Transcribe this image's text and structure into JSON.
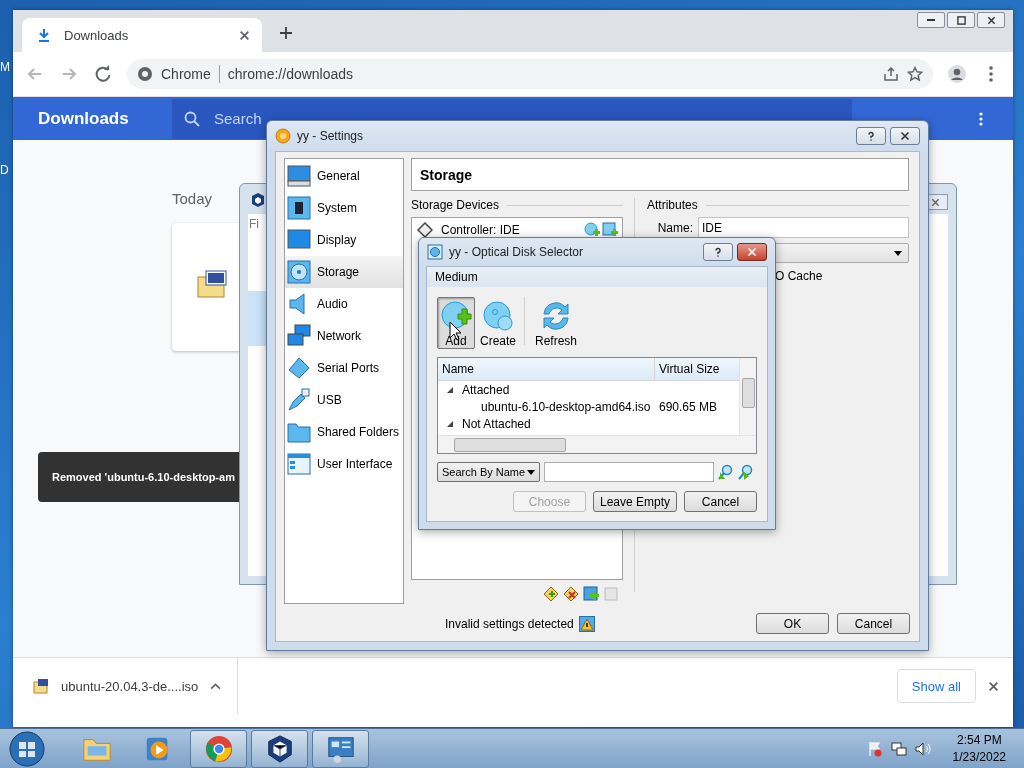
{
  "desktop": {
    "icon_labels": [
      "M",
      "D"
    ]
  },
  "browser": {
    "tab": {
      "title": "Downloads",
      "selected": true
    },
    "omnibox": {
      "chip": "Chrome",
      "url": "chrome://downloads"
    },
    "header": {
      "title": "Downloads",
      "search_placeholder": "Search"
    },
    "date_heading": "Today",
    "toast": "Removed 'ubuntu-6.10-desktop-am",
    "shelf": {
      "file": "ubuntu-20.04.3-de....iso",
      "show_all": "Show all"
    }
  },
  "manager_window": {
    "menu_fragment": "Fi"
  },
  "settings": {
    "title": "yy - Settings",
    "sections": [
      {
        "kind": "general",
        "label": "General",
        "selected": false
      },
      {
        "kind": "system",
        "label": "System",
        "selected": false
      },
      {
        "kind": "display",
        "label": "Display",
        "selected": false
      },
      {
        "kind": "storage",
        "label": "Storage",
        "selected": true
      },
      {
        "kind": "audio",
        "label": "Audio",
        "selected": false
      },
      {
        "kind": "network",
        "label": "Network",
        "selected": false
      },
      {
        "kind": "serial",
        "label": "Serial Ports",
        "selected": false
      },
      {
        "kind": "usb",
        "label": "USB",
        "selected": false
      },
      {
        "kind": "folders",
        "label": "Shared Folders",
        "selected": false
      },
      {
        "kind": "ui",
        "label": "User Interface",
        "selected": false
      }
    ],
    "page_title": "Storage",
    "devices_label": "Storage Devices",
    "controller": "Controller: IDE",
    "attributes_label": "Attributes",
    "name_label": "Name:",
    "name_value": "IDE",
    "cache_fragment": "O Cache",
    "status": "Invalid settings detected",
    "buttons": [
      "OK",
      "Cancel"
    ]
  },
  "disk_selector": {
    "title": "yy - Optical Disk Selector",
    "menu": [
      "Medium"
    ],
    "tools": [
      {
        "kind": "add",
        "label": "Add",
        "pressed": true
      },
      {
        "kind": "create",
        "label": "Create",
        "pressed": false
      },
      {
        "kind": "refresh",
        "label": "Refresh",
        "pressed": false
      }
    ],
    "columns": [
      "Name",
      "Virtual Size"
    ],
    "rows": [
      {
        "kind": "group",
        "name": "Attached",
        "expanded": true
      },
      {
        "kind": "item",
        "name": "ubuntu-6.10-desktop-amd64.iso",
        "size": "690.65 MB"
      },
      {
        "kind": "group",
        "name": "Not Attached",
        "expanded": true
      }
    ],
    "search_mode": "Search By Name",
    "buttons": [
      {
        "label": "Choose",
        "disabled": true
      },
      {
        "label": "Leave Empty",
        "disabled": false
      },
      {
        "label": "Cancel",
        "disabled": false
      }
    ]
  },
  "taskbar": {
    "apps": [
      {
        "kind": "explorer",
        "open": false
      },
      {
        "kind": "media",
        "open": false
      },
      {
        "kind": "browser",
        "open": true
      },
      {
        "kind": "virtualbox",
        "open": true
      },
      {
        "kind": "control",
        "open": true
      }
    ],
    "time": "2:54 PM",
    "date": "1/23/2022"
  }
}
